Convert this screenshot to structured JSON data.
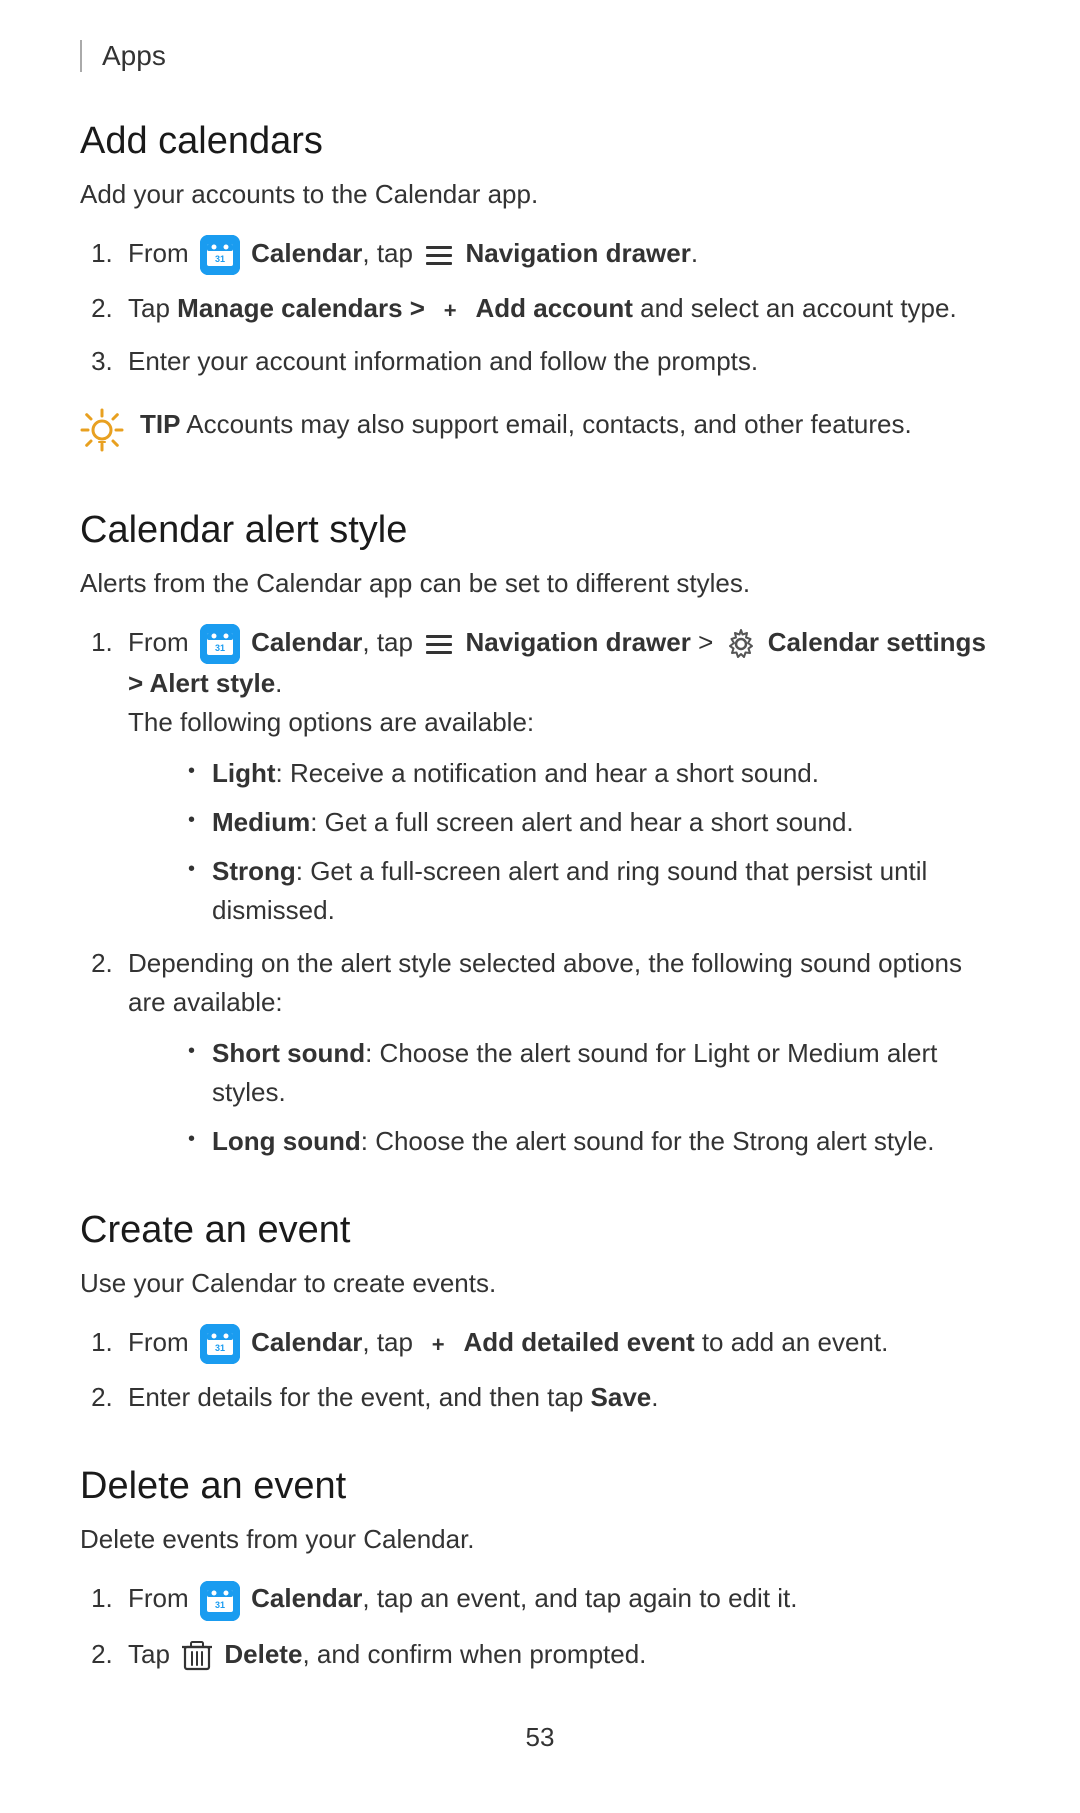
{
  "header": {
    "title": "Apps",
    "border_color": "#aaaaaa"
  },
  "sections": [
    {
      "id": "add-calendars",
      "heading": "Add calendars",
      "intro": "Add your accounts to the Calendar app.",
      "steps": [
        {
          "id": 1,
          "parts": [
            {
              "type": "text",
              "content": "From "
            },
            {
              "type": "calendar-icon"
            },
            {
              "type": "bold",
              "content": "Calendar"
            },
            {
              "type": "text",
              "content": ", tap "
            },
            {
              "type": "hamburger-icon"
            },
            {
              "type": "bold",
              "content": "Navigation drawer"
            },
            {
              "type": "text",
              "content": "."
            }
          ]
        },
        {
          "id": 2,
          "parts": [
            {
              "type": "text",
              "content": "Tap "
            },
            {
              "type": "bold",
              "content": "Manage calendars > "
            },
            {
              "type": "plus-icon"
            },
            {
              "type": "bold",
              "content": "Add account"
            },
            {
              "type": "text",
              "content": " and select an account type."
            }
          ]
        },
        {
          "id": 3,
          "text": "Enter your account information and follow the prompts."
        }
      ],
      "tip": {
        "label": "TIP",
        "text": "Accounts may also support email, contacts, and other features."
      }
    },
    {
      "id": "calendar-alert-style",
      "heading": "Calendar alert style",
      "intro": "Alerts from the Calendar app can be set to different styles.",
      "steps": [
        {
          "id": 1,
          "sub_intro": "The following options are available:",
          "parts": [
            {
              "type": "text",
              "content": "From "
            },
            {
              "type": "calendar-icon"
            },
            {
              "type": "bold",
              "content": "Calendar"
            },
            {
              "type": "text",
              "content": ", tap "
            },
            {
              "type": "hamburger-icon"
            },
            {
              "type": "bold",
              "content": "Navigation drawer"
            },
            {
              "type": "text",
              "content": " > "
            },
            {
              "type": "gear-icon"
            },
            {
              "type": "bold",
              "content": "Calendar settings > Alert style"
            },
            {
              "type": "text",
              "content": "."
            }
          ],
          "bullets": [
            {
              "bold": "Light",
              "text": ": Receive a notification and hear a short sound."
            },
            {
              "bold": "Medium",
              "text": ": Get a full screen alert and hear a short sound."
            },
            {
              "bold": "Strong",
              "text": ": Get a full-screen alert and ring sound that persist until dismissed."
            }
          ]
        },
        {
          "id": 2,
          "text": "Depending on the alert style selected above, the following sound options are available:",
          "bullets": [
            {
              "bold": "Short sound",
              "text": ": Choose the alert sound for Light or Medium alert styles."
            },
            {
              "bold": "Long sound",
              "text": ": Choose the alert sound for the Strong alert style."
            }
          ]
        }
      ]
    },
    {
      "id": "create-an-event",
      "heading": "Create an event",
      "intro": "Use your Calendar to create events.",
      "steps": [
        {
          "id": 1,
          "parts": [
            {
              "type": "text",
              "content": "From "
            },
            {
              "type": "calendar-icon"
            },
            {
              "type": "bold",
              "content": "Calendar"
            },
            {
              "type": "text",
              "content": ", tap "
            },
            {
              "type": "plus-icon"
            },
            {
              "type": "bold",
              "content": "Add detailed event"
            },
            {
              "type": "text",
              "content": " to add an event."
            }
          ]
        },
        {
          "id": 2,
          "parts": [
            {
              "type": "text",
              "content": "Enter details for the event, and then tap "
            },
            {
              "type": "bold",
              "content": "Save"
            },
            {
              "type": "text",
              "content": "."
            }
          ]
        }
      ]
    },
    {
      "id": "delete-an-event",
      "heading": "Delete an event",
      "intro": "Delete events from your Calendar.",
      "steps": [
        {
          "id": 1,
          "parts": [
            {
              "type": "text",
              "content": "From "
            },
            {
              "type": "calendar-icon"
            },
            {
              "type": "bold",
              "content": "Calendar"
            },
            {
              "type": "text",
              "content": ", tap an event, and tap again to edit it."
            }
          ]
        },
        {
          "id": 2,
          "parts": [
            {
              "type": "text",
              "content": "Tap "
            },
            {
              "type": "trash-icon"
            },
            {
              "type": "bold",
              "content": "Delete"
            },
            {
              "type": "text",
              "content": ", and confirm when prompted."
            }
          ]
        }
      ]
    }
  ],
  "page_number": "53"
}
